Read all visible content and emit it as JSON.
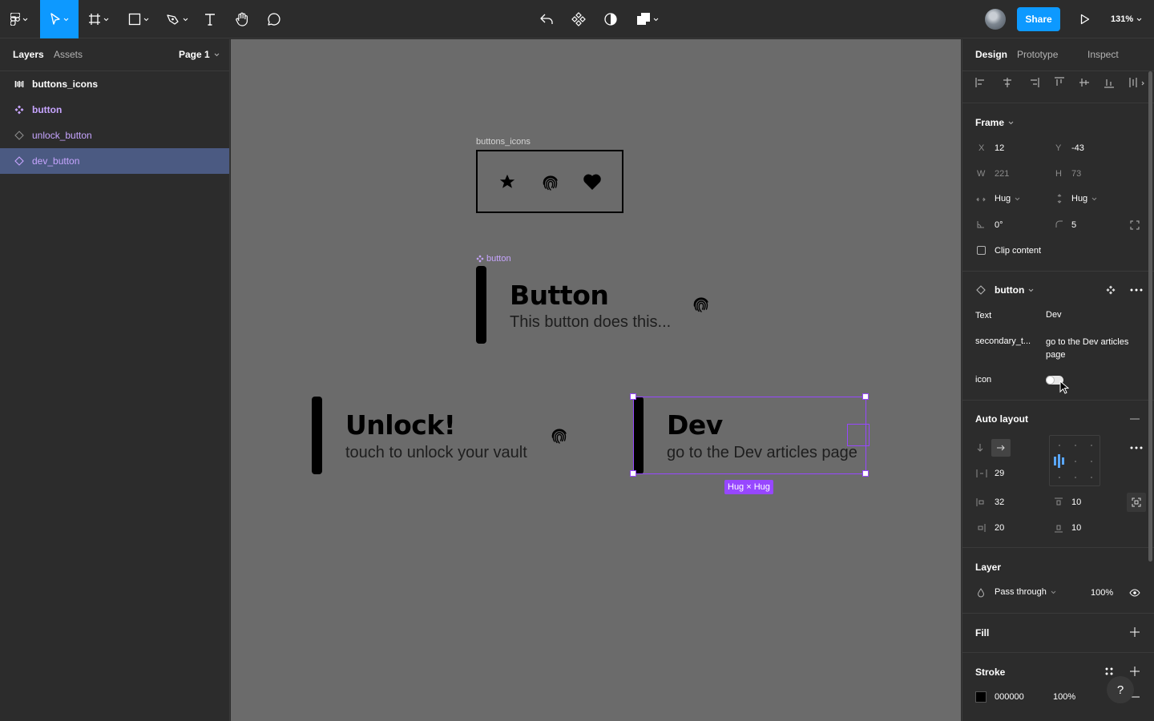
{
  "toolbar": {
    "share_label": "Share",
    "zoom": "131%"
  },
  "left_panel": {
    "tabs": [
      "Layers",
      "Assets"
    ],
    "page": "Page 1",
    "layers": [
      {
        "name": "buttons_icons",
        "kind": "frame"
      },
      {
        "name": "button",
        "kind": "component"
      },
      {
        "name": "unlock_button",
        "kind": "instance"
      },
      {
        "name": "dev_button",
        "kind": "instance",
        "selected": true
      }
    ]
  },
  "canvas": {
    "icons_frame_label": "buttons_icons",
    "component_label": "button",
    "component": {
      "title": "Button",
      "subtitle": "This button does this..."
    },
    "unlock": {
      "title": "Unlock!",
      "subtitle": "touch to unlock your vault"
    },
    "dev": {
      "title": "Dev",
      "subtitle": "go to the Dev articles page"
    },
    "size_badge": "Hug × Hug"
  },
  "right_panel": {
    "tabs": [
      "Design",
      "Prototype",
      "Inspect"
    ],
    "frame": {
      "title": "Frame",
      "x_label": "X",
      "x": "12",
      "y_label": "Y",
      "y": "-43",
      "w_label": "W",
      "w": "221",
      "h_label": "H",
      "h": "73",
      "h_sizing": "Hug",
      "v_sizing": "Hug",
      "rotation": "0°",
      "radius": "5",
      "clip_content": "Clip content"
    },
    "component": {
      "name": "button",
      "text_label": "Text",
      "text_value": "Dev",
      "secondary_label": "secondary_t...",
      "secondary_value": "go to the Dev articles page",
      "icon_label": "icon",
      "icon_enabled": false
    },
    "auto_layout": {
      "title": "Auto layout",
      "gap": "29",
      "padding_left": "32",
      "padding_top": "10",
      "padding_right": "20",
      "padding_bottom": "10"
    },
    "layer": {
      "title": "Layer",
      "blend": "Pass through",
      "opacity": "100%"
    },
    "fill": {
      "title": "Fill"
    },
    "stroke": {
      "title": "Stroke",
      "color": "000000",
      "opacity": "100%"
    }
  },
  "colors": {
    "accent": "#0d99ff",
    "selection": "#9747ff",
    "component": "#c7a5ff",
    "canvas": "#6b6b6b"
  }
}
